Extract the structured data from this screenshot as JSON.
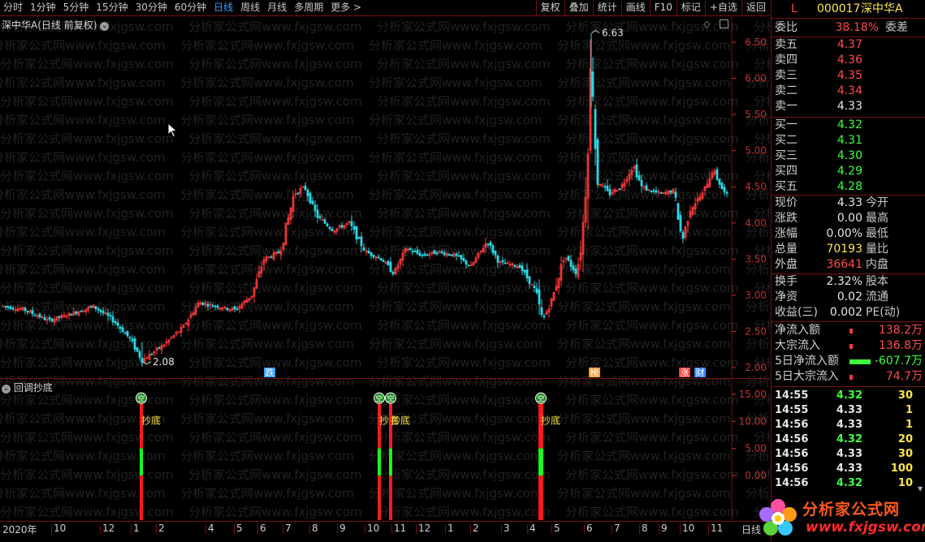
{
  "toolbar": {
    "periods": [
      "分时",
      "1分钟",
      "5分钟",
      "15分钟",
      "30分钟",
      "60分钟",
      "日线",
      "周线",
      "月线",
      "多周期",
      "更多 >"
    ],
    "active_period": "日线",
    "tools": [
      "复权",
      "叠加",
      "统计",
      "画线",
      "F10",
      "标记",
      "+自选",
      "返回"
    ]
  },
  "main": {
    "title": "深中华A(日线 前复权)",
    "high_label": "6.63",
    "low_label": "2.08",
    "price_axis": [
      "6.50",
      "6.00",
      "5.50",
      "5.00",
      "4.50",
      "4.00",
      "3.50",
      "3.00",
      "2.50",
      "2.00"
    ],
    "markers": [
      {
        "text": "跌",
        "color": "#39a0ff"
      },
      {
        "text": "榜",
        "color": "#ff9a3a"
      },
      {
        "text": "涨",
        "color": "#ff3a3a"
      },
      {
        "text": "财",
        "color": "#3a8aff"
      }
    ]
  },
  "sub": {
    "title": "回调抄底",
    "axis": [
      "15.00",
      "10.00",
      "5.00",
      "0.00"
    ],
    "signal_top": "空",
    "signal_label": "抄底"
  },
  "timeline": [
    "2020年",
    "10",
    "12",
    "1",
    "2",
    "4",
    "5",
    "6",
    "7",
    "8",
    "9",
    "10",
    "11",
    "12",
    "1",
    "2",
    "3",
    "4",
    "5",
    "6",
    "7",
    "8",
    "9",
    "10",
    "11",
    "日线"
  ],
  "panel": {
    "flag": "L",
    "code": "000017",
    "name": "深中华A",
    "weibi_label": "委比",
    "weibi_value": "38.18%",
    "weicha_label": "委差",
    "sells": [
      {
        "label": "卖五",
        "price": "4.37"
      },
      {
        "label": "卖四",
        "price": "4.36"
      },
      {
        "label": "卖三",
        "price": "4.35"
      },
      {
        "label": "卖二",
        "price": "4.34"
      },
      {
        "label": "卖一",
        "price": "4.33"
      }
    ],
    "buys": [
      {
        "label": "买一",
        "price": "4.32"
      },
      {
        "label": "买二",
        "price": "4.31"
      },
      {
        "label": "买三",
        "price": "4.30"
      },
      {
        "label": "买四",
        "price": "4.29"
      },
      {
        "label": "买五",
        "price": "4.28"
      }
    ],
    "stats": [
      {
        "l": "现价",
        "v": "4.33",
        "r": "今开",
        "vc": "w"
      },
      {
        "l": "涨跌",
        "v": "0.00",
        "r": "最高",
        "vc": "w"
      },
      {
        "l": "涨幅",
        "v": "0.00%",
        "r": "最低",
        "vc": "w"
      },
      {
        "l": "总量",
        "v": "70193",
        "r": "量比",
        "vc": "y"
      },
      {
        "l": "外盘",
        "v": "36641",
        "r": "内盘",
        "vc": "r"
      }
    ],
    "stats2": [
      {
        "l": "换手",
        "v": "2.32%",
        "r": "股本"
      },
      {
        "l": "净资",
        "v": "0.02",
        "r": "流通"
      },
      {
        "l": "收益(三)",
        "v": "0.002",
        "r": "PE(动)"
      }
    ],
    "flows": [
      {
        "l": "净流入额",
        "v": "138.2万",
        "c": "r"
      },
      {
        "l": "大宗流入",
        "v": "136.8万",
        "c": "r"
      },
      {
        "l": "5日净流入额",
        "v": "-607.7万",
        "c": "g"
      },
      {
        "l": "5日大宗流入",
        "v": "74.7万",
        "c": "r"
      }
    ],
    "ticks": [
      {
        "t": "14:55",
        "p": "4.32",
        "pc": "g",
        "v": "30"
      },
      {
        "t": "14:55",
        "p": "4.33",
        "pc": "w",
        "v": "1"
      },
      {
        "t": "14:56",
        "p": "4.33",
        "pc": "w",
        "v": "1"
      },
      {
        "t": "14:56",
        "p": "4.32",
        "pc": "g",
        "v": "20"
      },
      {
        "t": "14:56",
        "p": "4.33",
        "pc": "w",
        "v": "30"
      },
      {
        "t": "14:56",
        "p": "4.33",
        "pc": "w",
        "v": "100"
      },
      {
        "t": "14:56",
        "p": "4.32",
        "pc": "g",
        "v": "10"
      }
    ]
  },
  "watermark": "分析家公式网www.fxjgsw.com",
  "logo": {
    "cn": "分析家公式网",
    "url": "www.fxjgsw.com"
  },
  "colors": {
    "up": "#ff3a3a",
    "down": "#29d9e8",
    "border": "#7a1010",
    "accent": "#39a0ff"
  }
}
